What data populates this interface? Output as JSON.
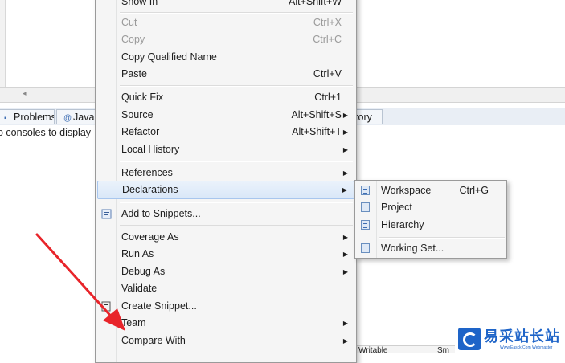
{
  "background": {
    "tabs": [
      {
        "label": "Problems",
        "icon": "problems-icon"
      },
      {
        "label": "Java",
        "icon": "javadoc-icon",
        "icon_glyph": "@"
      },
      {
        "label": "istory"
      }
    ],
    "console_message": "o consoles to display",
    "bottom_columns": [
      "Writable",
      "Sm"
    ]
  },
  "context_menu": {
    "partial_top": {
      "label": "Show In",
      "accelerator": "Alt+Shift+W"
    },
    "items": [
      {
        "label": "Cut",
        "accelerator": "Ctrl+X",
        "enabled": false
      },
      {
        "label": "Copy",
        "accelerator": "Ctrl+C",
        "enabled": false
      },
      {
        "label": "Copy Qualified Name",
        "accelerator": "",
        "enabled": true
      },
      {
        "label": "Paste",
        "accelerator": "Ctrl+V",
        "enabled": true
      },
      {
        "label": "Quick Fix",
        "accelerator": "Ctrl+1",
        "enabled": true
      },
      {
        "label": "Source",
        "accelerator": "Alt+Shift+S",
        "submenu": true
      },
      {
        "label": "Refactor",
        "accelerator": "Alt+Shift+T",
        "submenu": true
      },
      {
        "label": "Local History",
        "submenu": true
      },
      {
        "label": "References",
        "submenu": true
      },
      {
        "label": "Declarations",
        "submenu": true,
        "highlighted": true
      },
      {
        "label": "Add to Snippets...",
        "icon": "snippets-icon"
      },
      {
        "label": "Coverage As",
        "submenu": true
      },
      {
        "label": "Run As",
        "submenu": true
      },
      {
        "label": "Debug As",
        "submenu": true
      },
      {
        "label": "Validate"
      },
      {
        "label": "Create Snippet...",
        "icon": "create-snippet-icon"
      },
      {
        "label": "Team",
        "submenu": true
      },
      {
        "label": "Compare With",
        "submenu": true
      }
    ]
  },
  "declarations_submenu": {
    "items": [
      {
        "label": "Workspace",
        "accelerator": "Ctrl+G"
      },
      {
        "label": "Project",
        "accelerator": ""
      },
      {
        "label": "Hierarchy",
        "accelerator": ""
      },
      {
        "label": "Working Set...",
        "accelerator": ""
      }
    ]
  },
  "watermark": {
    "text": "易采站长站",
    "sub": "Www.Easck.Com  Webmaster"
  },
  "colors": {
    "highlight_border": "#a8c6ee",
    "arrow_red": "#e8242a",
    "watermark_blue": "#1e64c8"
  }
}
